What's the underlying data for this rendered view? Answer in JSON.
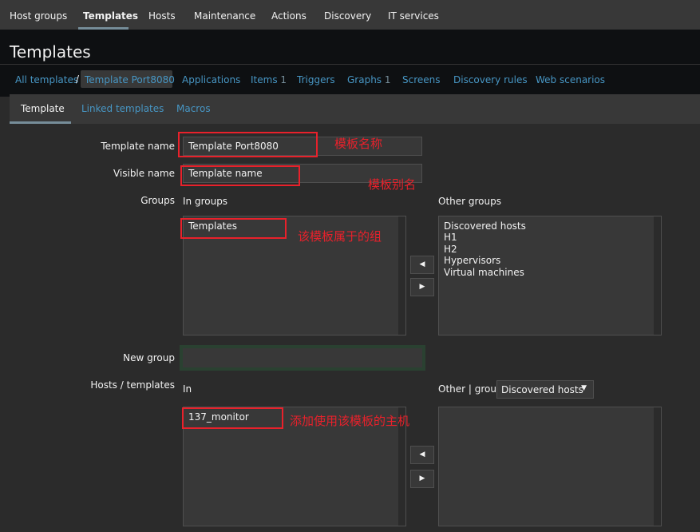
{
  "top_nav": [
    "Host groups",
    "Templates",
    "Hosts",
    "Maintenance",
    "Actions",
    "Discovery",
    "IT services"
  ],
  "page_title": "Templates",
  "breadcrumb": {
    "all_templates": "All templates",
    "separator": "/",
    "current": "Template Port8080",
    "links": [
      {
        "label": "Applications",
        "count": ""
      },
      {
        "label": "Items",
        "count": "1"
      },
      {
        "label": "Triggers",
        "count": ""
      },
      {
        "label": "Graphs",
        "count": "1"
      },
      {
        "label": "Screens",
        "count": ""
      },
      {
        "label": "Discovery rules",
        "count": ""
      },
      {
        "label": "Web scenarios",
        "count": ""
      }
    ]
  },
  "tabs": [
    "Template",
    "Linked templates",
    "Macros"
  ],
  "form": {
    "template_name_label": "Template name",
    "template_name_value": "Template Port8080",
    "visible_name_label": "Visible name",
    "visible_name_value": "Template name",
    "groups_label": "Groups",
    "in_groups_label": "In groups",
    "other_groups_label": "Other groups",
    "in_groups": [
      "Templates"
    ],
    "other_groups": [
      "Discovered hosts",
      "H1",
      "H2",
      "Hypervisors",
      "Virtual machines"
    ],
    "new_group_label": "New group",
    "new_group_value": "",
    "hosts_templates_label": "Hosts / templates",
    "in_label": "In",
    "other_group_label": "Other | group",
    "other_group_select": "Discovered hosts",
    "in_hosts": [
      "137_monitor"
    ],
    "other_hosts": []
  },
  "annotations": {
    "template_name": "模板名称",
    "visible_name": "模板别名",
    "groups": "该模板属于的组",
    "hosts": "添加使用该模板的主机"
  },
  "colors": {
    "background": "#2b2b2b",
    "header": "#0e1012",
    "link": "#4796c4",
    "annotation": "#e8212b"
  }
}
